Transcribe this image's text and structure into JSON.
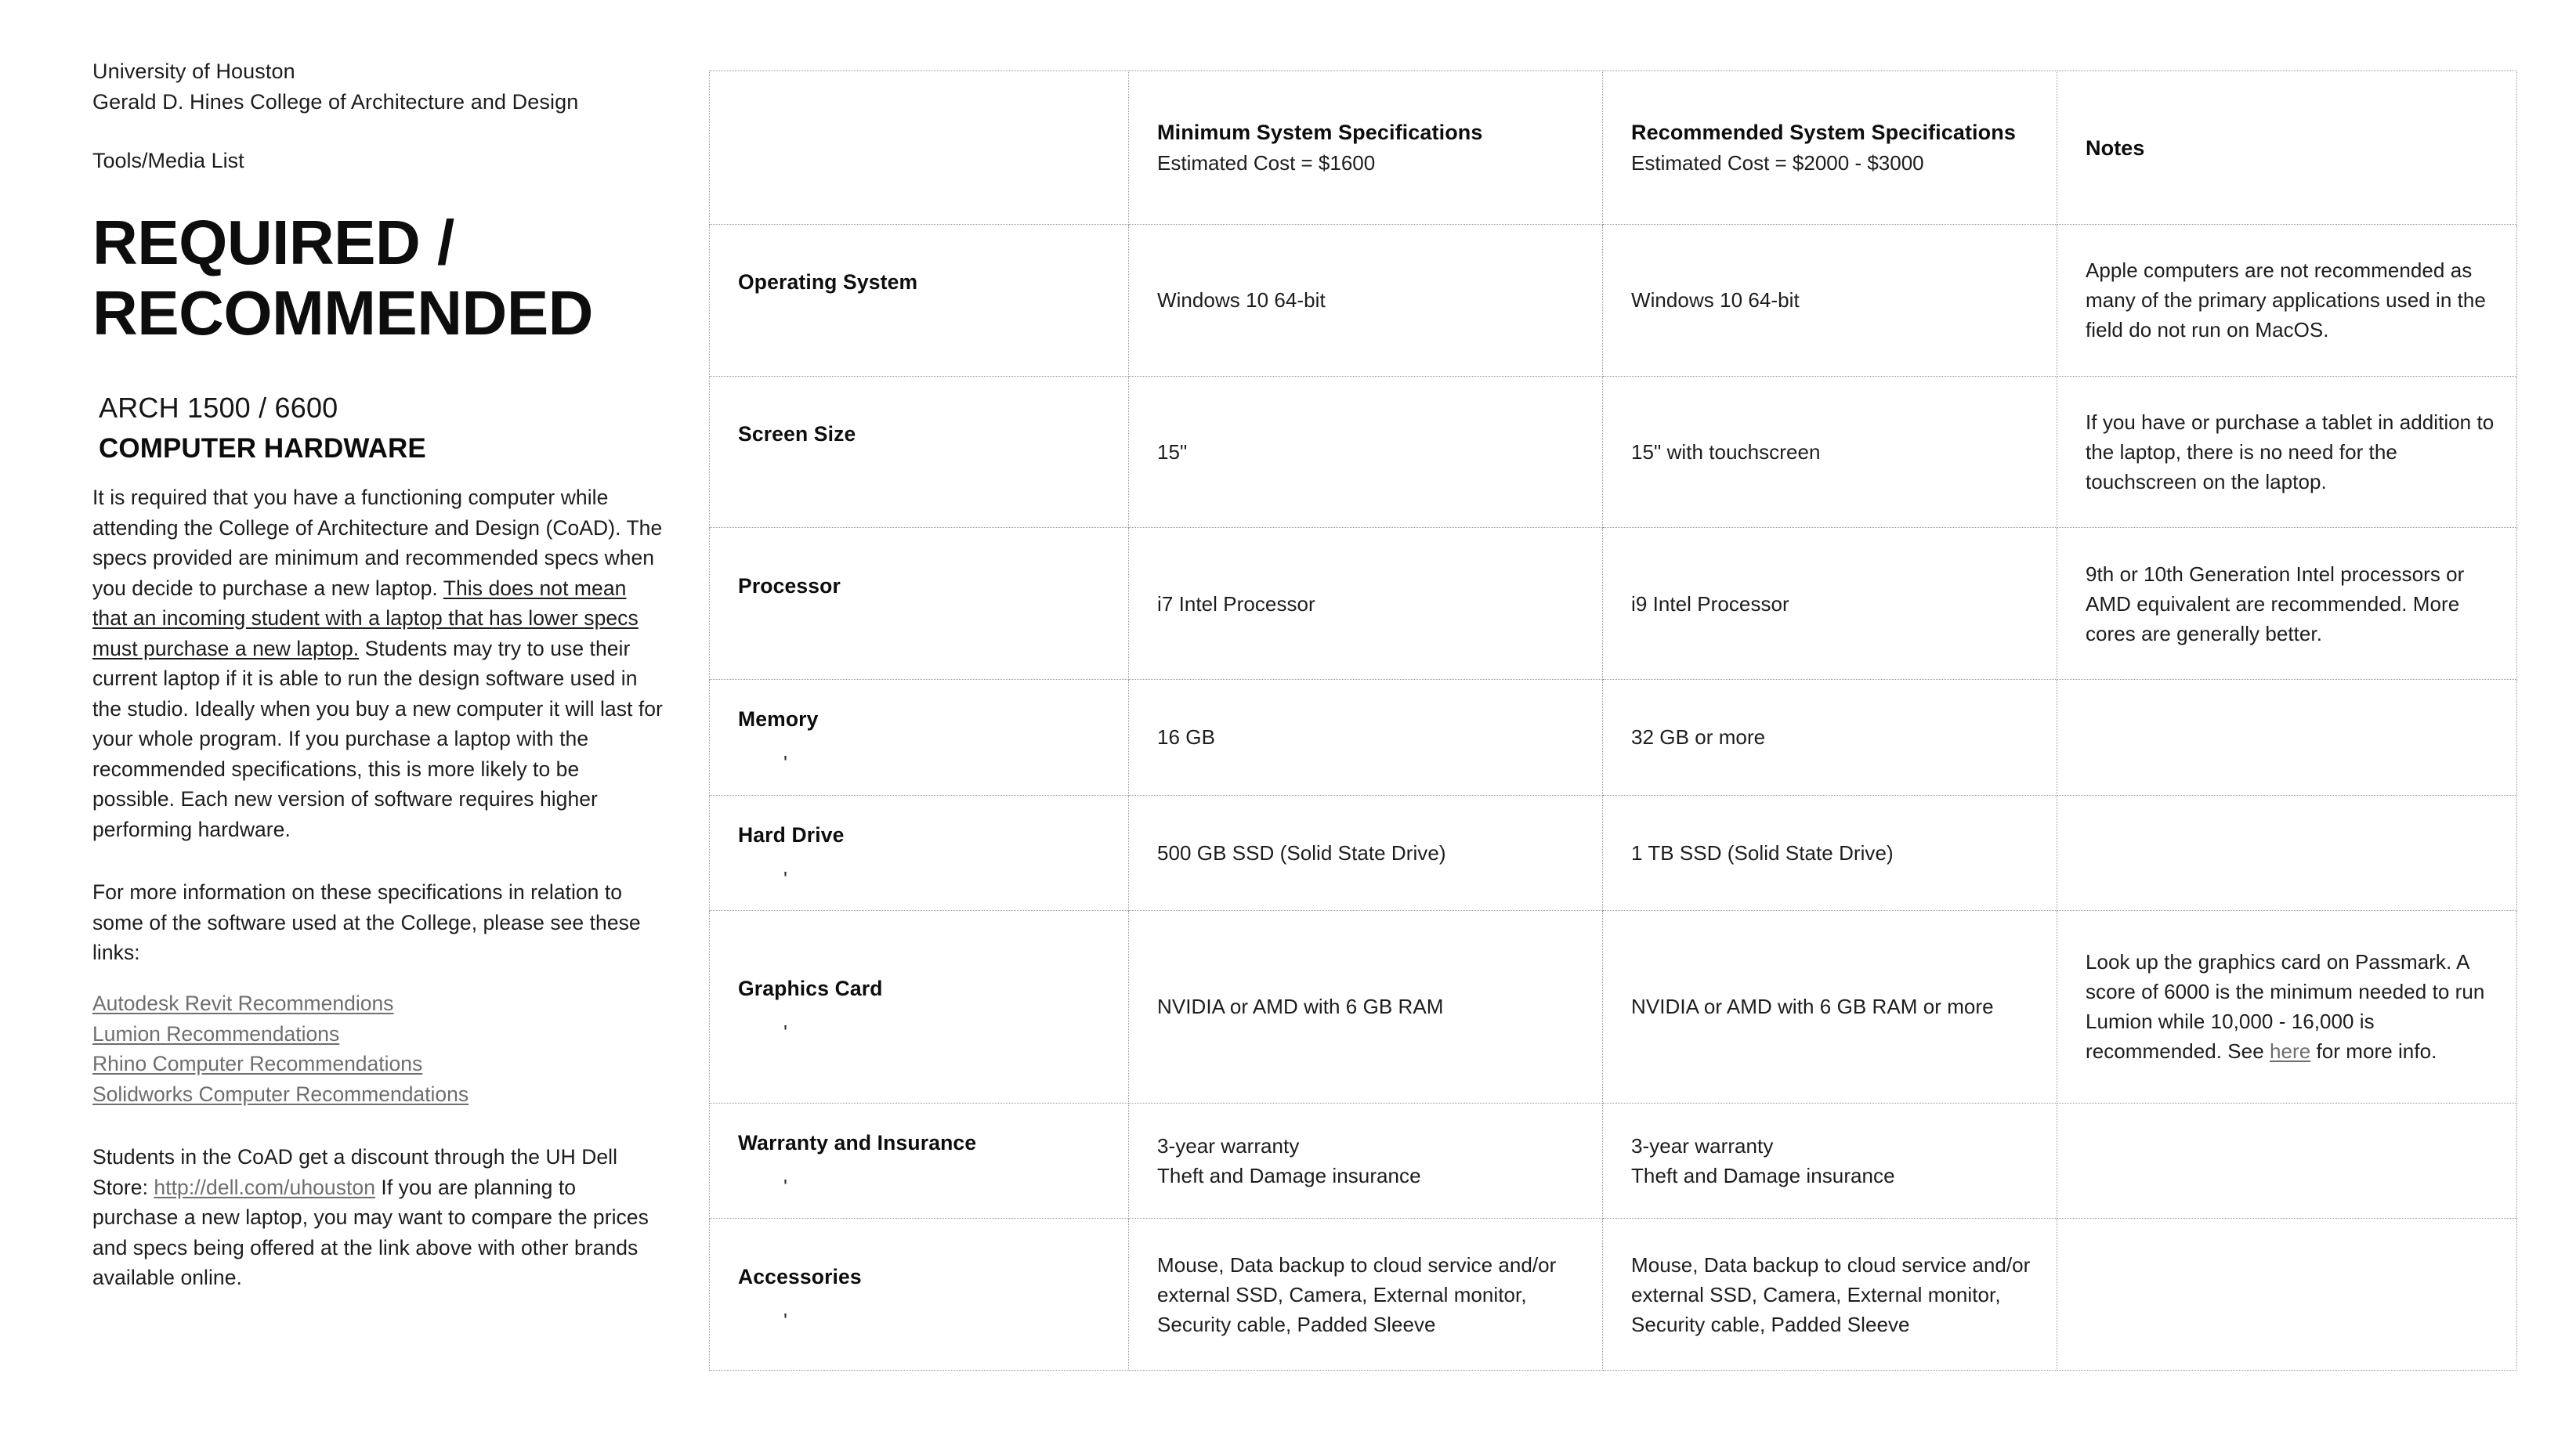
{
  "document": {
    "organization_line1": "University of Houston",
    "organization_line2": "Gerald D. Hines College of Architecture and Design",
    "list_label": "Tools/Media List",
    "title_line1": "REQUIRED /",
    "title_line2": "RECOMMENDED",
    "course_code": "ARCH 1500 / 6600",
    "subject": "COMPUTER HARDWARE"
  },
  "intro": {
    "para1_a": "It is required that you have a functioning computer while attending the College of Architecture and Design (CoAD).   The specs provided are minimum and recommended specs when you decide to purchase a new laptop.  ",
    "para1_underlined": "This does not mean that an incoming student with a laptop that has lower specs must purchase a new laptop.",
    "para1_b": "  Students may try to use their current laptop if it is able to run the design software used in the studio.  Ideally when you buy a new computer it will last for your whole program. If you purchase a laptop with the recommended specifications, this is more likely to be possible. Each new version of software requires higher performing hardware.",
    "para2": "For more information on these specifications in relation to some of the software used at the College, please see these links:",
    "links": [
      "Autodesk Revit Recommendions",
      "Lumion Recommendations",
      "Rhino Computer Recommendations",
      "Solidworks Computer Recommendations"
    ],
    "para3_a": "Students in the CoAD get a discount through the UH Dell Store: ",
    "para3_link": "http://dell.com/uhouston",
    "para3_b": "  If you are planning to purchase a new laptop, you may want to compare the prices and specs being offered at the link above with other brands available online."
  },
  "table": {
    "headers": {
      "blank": "",
      "minimum_title": "Minimum System Specifications",
      "minimum_sub": "Estimated Cost = $1600",
      "recommended_title": "Recommended System Specifications",
      "recommended_sub": "Estimated Cost = $2000 - $3000",
      "notes_title": "Notes"
    },
    "rows": [
      {
        "label": "Operating System",
        "mark": "",
        "minimum": "Windows 10 64-bit",
        "recommended": "Windows 10 64-bit",
        "notes": "Apple computers are not recommended as many of the primary applications used in the field do not run on MacOS."
      },
      {
        "label": "Screen Size",
        "mark": "",
        "minimum": "15\"",
        "recommended": "15\" with touchscreen",
        "notes": "If you have or purchase a tablet in addition to the laptop, there is no need for the touchscreen on the laptop."
      },
      {
        "label": "Processor",
        "mark": "",
        "minimum": "i7 Intel Processor",
        "recommended": "i9 Intel Processor",
        "notes": "9th or 10th Generation Intel processors or AMD equivalent  are recommended. More cores are generally better."
      },
      {
        "label": "Memory",
        "mark": "'",
        "minimum": "16 GB",
        "recommended": "32 GB or more",
        "notes": ""
      },
      {
        "label": "Hard Drive",
        "mark": "'",
        "minimum": "500 GB SSD (Solid State Drive)",
        "recommended": "1 TB SSD (Solid State Drive)",
        "notes": ""
      },
      {
        "label": "Graphics Card",
        "mark": "'",
        "minimum": "NVIDIA or AMD with 6 GB RAM",
        "recommended": "NVIDIA or AMD with 6 GB RAM or more",
        "notes_a": "Look up the graphics card on Passmark. A score of 6000 is the minimum needed to run Lumion while 10,000 - 16,000 is recommended. See ",
        "notes_link": "here",
        "notes_b": " for more info."
      },
      {
        "label": "Warranty and Insurance",
        "mark": "'",
        "minimum": "3-year warranty\nTheft and Damage insurance",
        "recommended": "3-year warranty\nTheft and Damage insurance",
        "notes": ""
      },
      {
        "label": "Accessories",
        "mark": "'",
        "minimum": "Mouse, Data backup to cloud service and/or external SSD, Camera, External monitor, Security cable, Padded Sleeve",
        "recommended": "Mouse, Data backup to cloud service and/or external SSD, Camera, External monitor, Security cable, Padded Sleeve",
        "notes": ""
      }
    ]
  },
  "colors": {
    "text": "#1d1d1d",
    "heading": "#0d0d0d",
    "link": "#6d6e70",
    "border": "#9a9a9a",
    "background": "#ffffff"
  }
}
